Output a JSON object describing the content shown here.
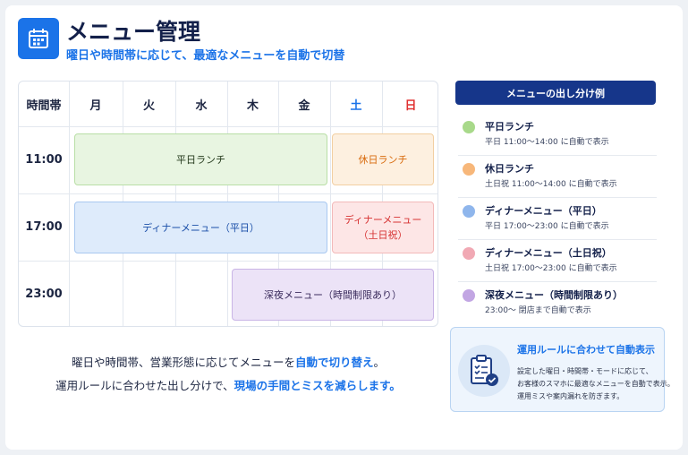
{
  "header": {
    "title": "メニュー管理",
    "subtitle": "曜日や時間帯に応じて、最適なメニューを自動で切替",
    "icon": "calendar-icon"
  },
  "schedule": {
    "corner_label": "時間帯",
    "days": [
      "月",
      "火",
      "水",
      "木",
      "金",
      "土",
      "日"
    ],
    "times": [
      "11:00",
      "17:00",
      "23:00"
    ],
    "blocks": [
      {
        "label": "平日ランチ",
        "time": "11:00",
        "days": "月-金"
      },
      {
        "label": "休日ランチ",
        "time": "11:00",
        "days": "土-日"
      },
      {
        "label": "ディナーメニュー（平日）",
        "time": "17:00",
        "days": "月-金"
      },
      {
        "label_line1": "ディナーメニュー",
        "label_line2": "（土日祝）",
        "time": "17:00",
        "days": "土-日"
      },
      {
        "label": "深夜メニュー（時間制限あり）",
        "time": "23:00",
        "days": "木-日"
      }
    ],
    "day_colors": {
      "sat": "#1b73e8",
      "sun": "#e03131"
    }
  },
  "legend": {
    "title": "メニューの出し分け例",
    "items": [
      {
        "name": "平日ランチ",
        "desc": "平日 11:00〜14:00 に自動で表示",
        "color": "#a8d98a"
      },
      {
        "name": "休日ランチ",
        "desc": "土日祝 11:00〜14:00 に自動で表示",
        "color": "#f7b77a"
      },
      {
        "name": "ディナーメニュー（平日）",
        "desc": "平日 17:00〜23:00 に自動で表示",
        "color": "#8fb6ec"
      },
      {
        "name": "ディナーメニュー（土日祝）",
        "desc": "土日祝 17:00〜23:00 に自動で表示",
        "color": "#f1a9b4"
      },
      {
        "name": "深夜メニュー（時間制限あり）",
        "desc": "23:00〜 閉店まで自動で表示",
        "color": "#c2a6e3"
      }
    ]
  },
  "info": {
    "icon": "clipboard-check-icon",
    "title": "運用ルールに合わせて自動表示",
    "lines": [
      "設定した曜日・時間帯・モードに応じて、",
      "お客様のスマホに最適なメニューを自動で表示。",
      "運用ミスや案内漏れを防ぎます。"
    ]
  },
  "caption": {
    "line1_a": "曜日や時間帯、営業形態に応じてメニューを",
    "line1_hl": "自動で切り替え",
    "line1_b": "。",
    "line2_a": "運用ルールに合わせた出し分けで、",
    "line2_hl": "現場の手間とミスを減らします。"
  }
}
